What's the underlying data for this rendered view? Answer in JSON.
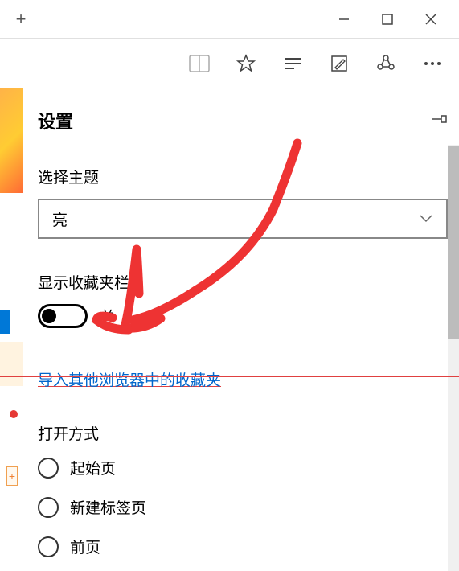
{
  "titlebar": {
    "new_tab": "+"
  },
  "settings": {
    "title": "设置",
    "theme": {
      "label": "选择主题",
      "value": "亮"
    },
    "favorites_bar": {
      "label": "显示收藏夹栏",
      "state_label": "关",
      "on": false
    },
    "import_link": "导入其他浏览器中的收藏夹",
    "open_with": {
      "label": "打开方式",
      "options": [
        "起始页",
        "新建标签页",
        "前页"
      ]
    }
  }
}
